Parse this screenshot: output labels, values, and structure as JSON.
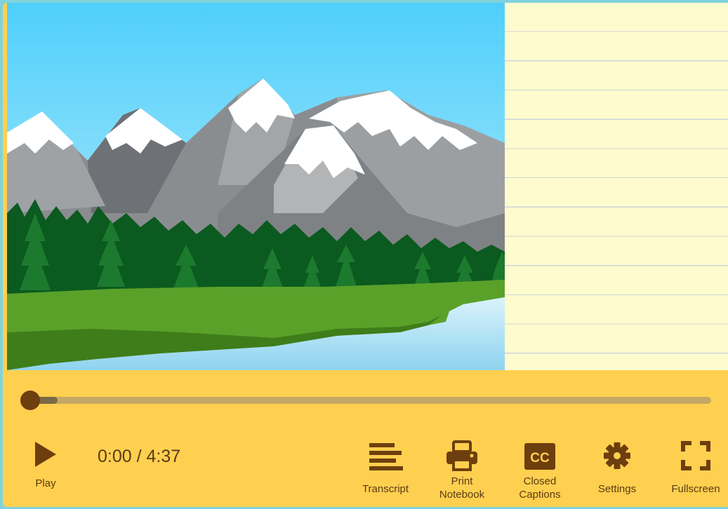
{
  "player": {
    "time_display": "0:00 / 4:37",
    "progress_fraction": 0.0
  },
  "controls": {
    "play_label": "Play",
    "transcript_label": "Transcript",
    "print_label_line1": "Print",
    "print_label_line2": "Notebook",
    "cc_label_line1": "Closed",
    "cc_label_line2": "Captions",
    "settings_label": "Settings",
    "fullscreen_label": "Fullscreen",
    "cc_icon_text": "CC"
  },
  "colors": {
    "control_bar": "#ffd04f",
    "accent_brown": "#6e3f0e",
    "notebook_paper": "#fefbcf",
    "sky_top": "#4fcffb"
  },
  "icons": [
    "play-icon",
    "transcript-icon",
    "printer-icon",
    "closed-captions-icon",
    "gear-icon",
    "fullscreen-icon"
  ]
}
